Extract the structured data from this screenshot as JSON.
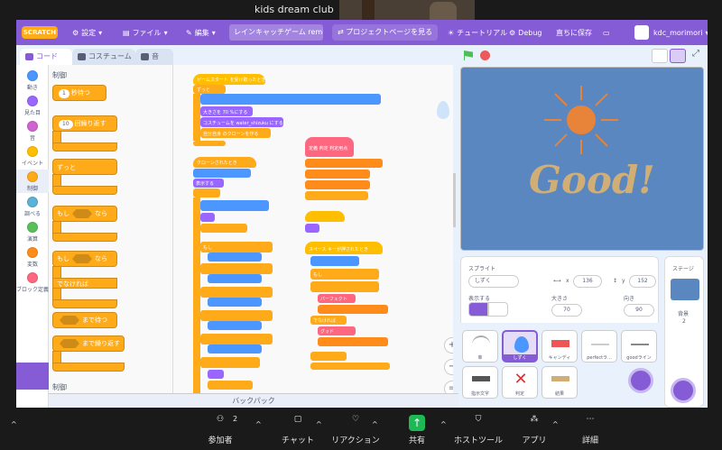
{
  "zoom": {
    "window_title": "kids dream club",
    "toolbar": [
      {
        "label": "参加者",
        "badge": "2"
      },
      {
        "label": "チャット"
      },
      {
        "label": "リアクション"
      },
      {
        "label": "共有"
      },
      {
        "label": "ホストツール"
      },
      {
        "label": "アプリ"
      },
      {
        "label": "詳細"
      }
    ]
  },
  "scratch": {
    "logo": "SCRATCH",
    "menu": {
      "settings": "設定",
      "file": "ファイル",
      "edit": "編集",
      "project_title": "レインキャッチゲーム remi...",
      "project_page": "プロジェクトページを見る",
      "tutorial": "チュートリアル",
      "debug": "Debug",
      "save_now": "直ちに保存",
      "username": "kdc_morimori"
    },
    "tabs": {
      "code": "コード",
      "costume": "コスチューム",
      "sound": "音"
    },
    "categories": [
      {
        "label": "動き",
        "color": "#4c97ff"
      },
      {
        "label": "見た目",
        "color": "#9966ff"
      },
      {
        "label": "音",
        "color": "#cf63cf"
      },
      {
        "label": "イベント",
        "color": "#ffbf00"
      },
      {
        "label": "制御",
        "color": "#ffab19"
      },
      {
        "label": "調べる",
        "color": "#5cb1d6"
      },
      {
        "label": "演算",
        "color": "#59c059"
      },
      {
        "label": "変数",
        "color": "#ff8c1a"
      },
      {
        "label": "ブロック定義",
        "color": "#ff6680"
      }
    ],
    "palette": {
      "heading": "制御",
      "heading2": "制御",
      "wait_value": "1",
      "wait_suffix": "秒待つ",
      "repeat_value": "10",
      "repeat_suffix": "回繰り返す",
      "forever": "ずっと",
      "if_prefix": "もし",
      "if_suffix": "なら",
      "if2_prefix": "もし",
      "if2_suffix": "なら",
      "else": "でなければ",
      "wait_until": "まで待つ",
      "repeat_until": "まで繰り返す"
    },
    "workspace": {
      "script1_hat": "ゲームスタート を受け取ったとき",
      "script1_forever": "ずっと",
      "script1_size": "大きさを 70 %にする",
      "script1_costume": "コスチュームを water_shizuku にする",
      "script1_clone": "自分自身 のクローンを作る",
      "script2_hat": "クローンされたとき",
      "script2_show": "表示する",
      "script3_hat": "定義 判定 判定用点",
      "script4_hat": "スペース キーが押されたとき",
      "if_label": "もし",
      "then_label": "なら",
      "else_label": "でなければ",
      "perfect": "パーフェクト",
      "good": "グッド"
    },
    "backpack": "バックパック",
    "stage_text": "Good!",
    "sprite": {
      "label": "スプライト",
      "name": "しずく",
      "x_label": "x",
      "x_value": "136",
      "y_label": "y",
      "y_value": "152",
      "show_label": "表示する",
      "size_label": "大きさ",
      "size_value": "70",
      "direction_label": "向き",
      "direction_value": "90"
    },
    "sprite_tiles": [
      {
        "name": "傘"
      },
      {
        "name": "しずく"
      },
      {
        "name": "キャンディ"
      },
      {
        "name": "perfectラ..."
      },
      {
        "name": "goodライン"
      },
      {
        "name": "指示文字"
      },
      {
        "name": "判定"
      },
      {
        "name": "結果"
      }
    ],
    "stage_panel": {
      "label": "ステージ",
      "backdrop_label": "背景",
      "backdrop_count": "2"
    },
    "colors": {
      "purple": "#855cd6",
      "control": "#ffab19",
      "stage_bg": "#5a87bf"
    }
  }
}
